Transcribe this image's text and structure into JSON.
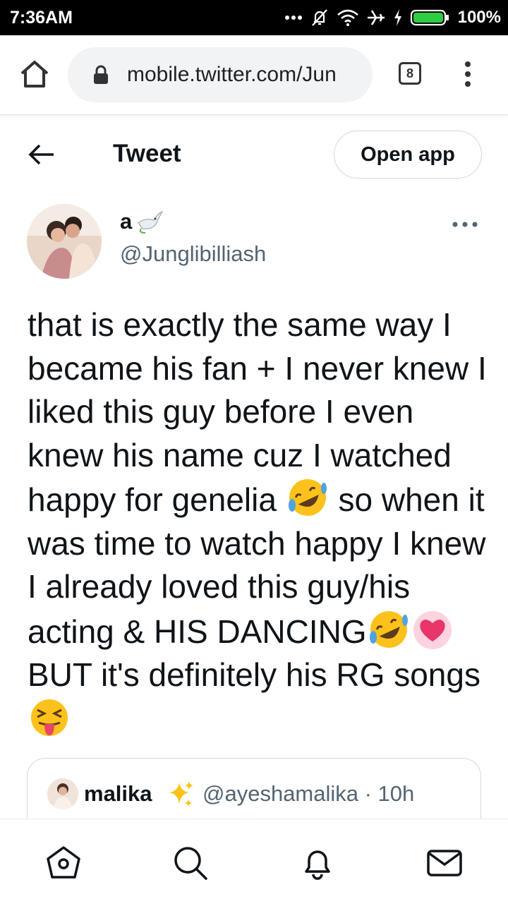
{
  "status_bar": {
    "time": "7:36AM",
    "battery_percent": "100%",
    "icons": [
      "dots-icon",
      "bell-muted-icon",
      "wifi-icon",
      "airplane-icon",
      "charging-icon",
      "battery-icon"
    ]
  },
  "browser": {
    "url": "mobile.twitter.com/Jun",
    "tab_count": "8"
  },
  "header": {
    "title": "Tweet",
    "open_app_label": "Open app"
  },
  "tweet": {
    "display_name": "a",
    "username": "@Junglibilliash",
    "text_parts": [
      "that is exactly the same way I became his fan + I never knew I liked this guy before I even knew his name cuz I watched happy for genelia",
      "so when it was time to watch happy I knew I already loved this guy/his acting & HIS DANCING",
      "BUT it's definitely his RG songs"
    ],
    "emojis": [
      "rofl-emoji",
      "rofl-emoji",
      "heart-emoji",
      "tongue-emoji"
    ]
  },
  "quoted_tweet": {
    "display_name": "malika",
    "handle_time": "@ayeshamalika · 10h"
  },
  "bottom_nav": {
    "items": [
      "home-icon",
      "search-icon",
      "notifications-icon",
      "messages-icon"
    ]
  },
  "colors": {
    "text_primary": "#0f1419",
    "text_secondary": "#536471",
    "border": "#cfd9de",
    "status_bar": "#000000",
    "battery": "#2ecc40"
  }
}
